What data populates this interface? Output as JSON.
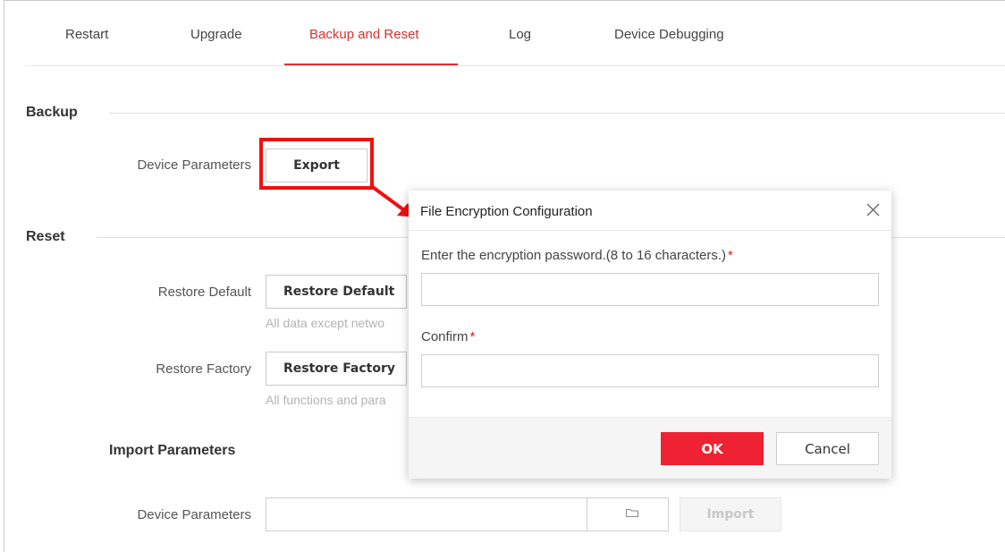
{
  "tabs": [
    {
      "label": "Restart"
    },
    {
      "label": "Upgrade"
    },
    {
      "label": "Backup and Reset",
      "active": true
    },
    {
      "label": "Log"
    },
    {
      "label": "Device Debugging"
    }
  ],
  "backup": {
    "title": "Backup",
    "device_parameters_label": "Device Parameters",
    "export_label": "Export"
  },
  "reset": {
    "title": "Reset",
    "restore_default_label": "Restore Default",
    "restore_default_button": "Restore Default",
    "restore_default_hint": "All data except netwo",
    "restore_factory_label": "Restore Factory",
    "restore_factory_button": "Restore Factory",
    "restore_factory_hint": "All functions and para"
  },
  "import": {
    "title": "Import Parameters",
    "device_parameters_label": "Device Parameters",
    "file_value": "",
    "folder_icon": "folder-icon",
    "import_label": "Import"
  },
  "modal": {
    "title": "File Encryption Configuration",
    "close_icon": "close-icon",
    "password_label": "Enter the encryption password.(8 to 16 characters.)",
    "password_required": "*",
    "password_value": "",
    "confirm_label": "Confirm",
    "confirm_required": "*",
    "confirm_value": "",
    "ok_label": "OK",
    "cancel_label": "Cancel"
  },
  "colors": {
    "accent": "#d9302f",
    "ok_button": "#ee2233",
    "annotation": "#ee1111"
  }
}
